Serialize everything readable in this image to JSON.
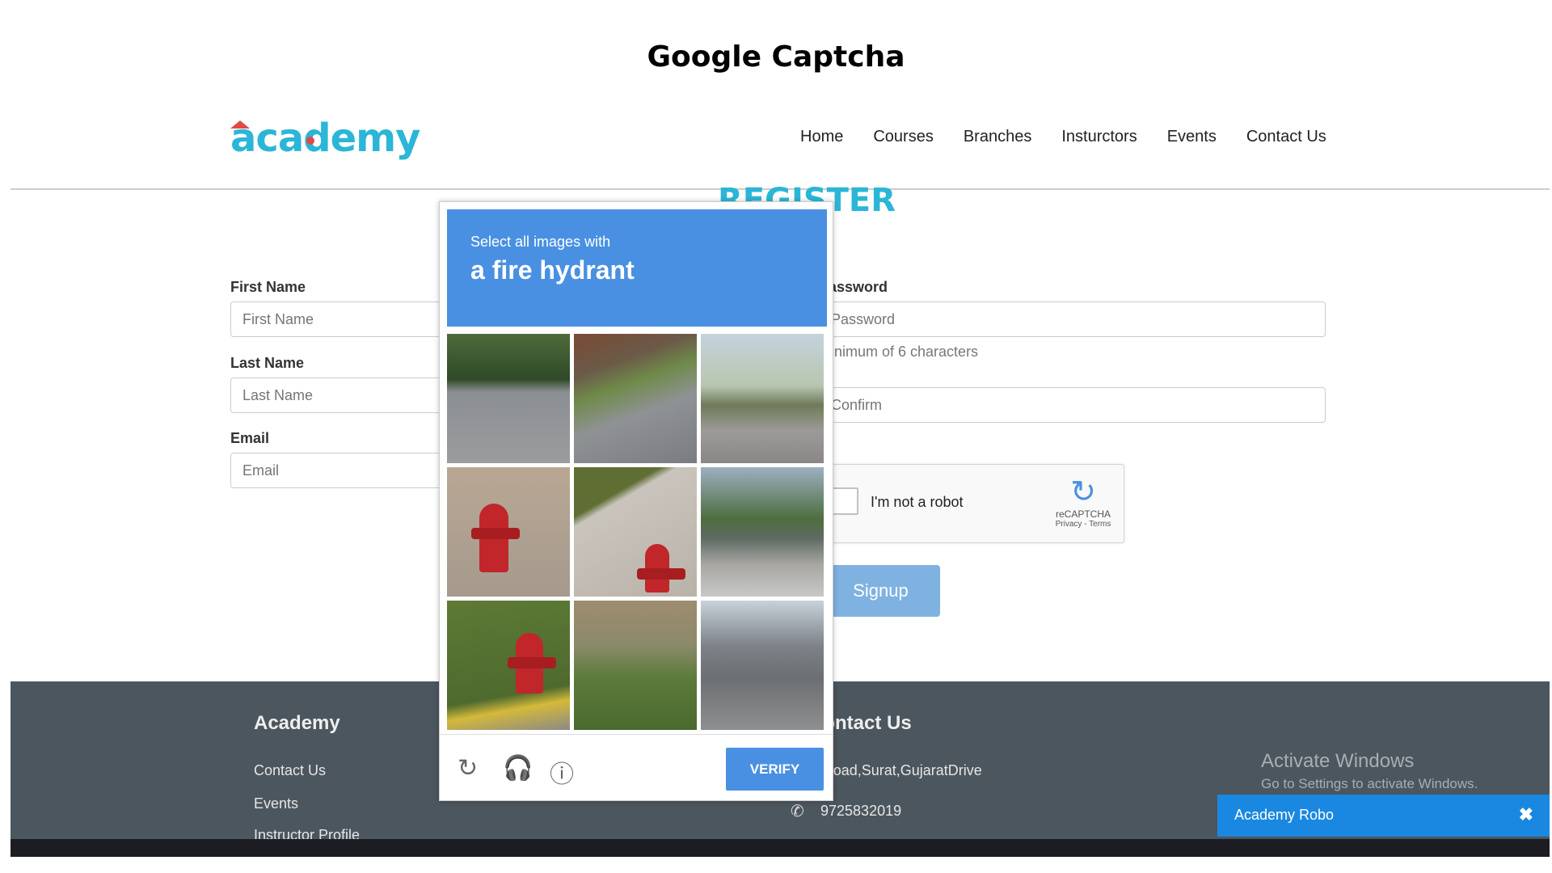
{
  "slide": {
    "title": "Google Captcha"
  },
  "header": {
    "logo": "academy",
    "nav": [
      "Home",
      "Courses",
      "Branches",
      "Insturctors",
      "Events",
      "Contact Us"
    ]
  },
  "register": {
    "heading": "REGISTER"
  },
  "form": {
    "first_name": {
      "label": "First Name",
      "placeholder": "First Name"
    },
    "last_name": {
      "label": "Last Name",
      "placeholder": "Last Name"
    },
    "email": {
      "label": "Email",
      "placeholder": "Email"
    },
    "password": {
      "label": "Password",
      "placeholder": "Password",
      "hint": "Minimum of 6 characters"
    },
    "confirm": {
      "placeholder": "Confirm"
    },
    "recaptcha": {
      "text": "I'm not a robot",
      "brand": "reCAPTCHA",
      "terms": "Privacy - Terms"
    },
    "signup_label": "Signup"
  },
  "captcha": {
    "instruction_small": "Select all images with",
    "instruction_big": "a fire hydrant",
    "verify_label": "VERIFY",
    "tiles": [
      "road",
      "road",
      "street with palm trees",
      "fire hydrant",
      "fire hydrant",
      "road",
      "fire hydrant",
      "bushes",
      "city street"
    ],
    "icons": [
      "reload-icon",
      "headphones-icon",
      "info-icon"
    ]
  },
  "footer": {
    "col1_title": "Academy",
    "col1_links": [
      "Contact Us",
      "Events",
      "Instructor Profile"
    ],
    "col2_title": "Contact Us",
    "address": "Vipload,Surat,GujaratDrive",
    "phone": "9725832019"
  },
  "watermark": {
    "line1": "Activate Windows",
    "line2": "Go to Settings to activate Windows."
  },
  "chat": {
    "title": "Academy Robo",
    "close": "✖"
  },
  "colors": {
    "accent": "#4a90e2",
    "logo": "#2bb6d8",
    "footer": "#4c565e",
    "chat": "#1a88e0",
    "signup": "#7fb2e0"
  }
}
